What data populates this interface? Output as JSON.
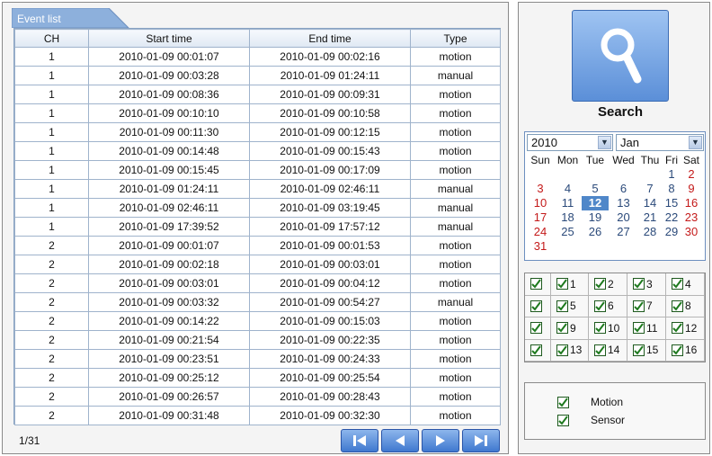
{
  "event_list": {
    "tab_label": "Event list",
    "columns": [
      "CH",
      "Start time",
      "End time",
      "Type"
    ],
    "rows": [
      [
        "1",
        "2010-01-09 00:01:07",
        "2010-01-09 00:02:16",
        "motion"
      ],
      [
        "1",
        "2010-01-09 00:03:28",
        "2010-01-09 01:24:11",
        "manual"
      ],
      [
        "1",
        "2010-01-09 00:08:36",
        "2010-01-09 00:09:31",
        "motion"
      ],
      [
        "1",
        "2010-01-09 00:10:10",
        "2010-01-09 00:10:58",
        "motion"
      ],
      [
        "1",
        "2010-01-09 00:11:30",
        "2010-01-09 00:12:15",
        "motion"
      ],
      [
        "1",
        "2010-01-09 00:14:48",
        "2010-01-09 00:15:43",
        "motion"
      ],
      [
        "1",
        "2010-01-09 00:15:45",
        "2010-01-09 00:17:09",
        "motion"
      ],
      [
        "1",
        "2010-01-09 01:24:11",
        "2010-01-09 02:46:11",
        "manual"
      ],
      [
        "1",
        "2010-01-09 02:46:11",
        "2010-01-09 03:19:45",
        "manual"
      ],
      [
        "1",
        "2010-01-09 17:39:52",
        "2010-01-09 17:57:12",
        "manual"
      ],
      [
        "2",
        "2010-01-09 00:01:07",
        "2010-01-09 00:01:53",
        "motion"
      ],
      [
        "2",
        "2010-01-09 00:02:18",
        "2010-01-09 00:03:01",
        "motion"
      ],
      [
        "2",
        "2010-01-09 00:03:01",
        "2010-01-09 00:04:12",
        "motion"
      ],
      [
        "2",
        "2010-01-09 00:03:32",
        "2010-01-09 00:54:27",
        "manual"
      ],
      [
        "2",
        "2010-01-09 00:14:22",
        "2010-01-09 00:15:03",
        "motion"
      ],
      [
        "2",
        "2010-01-09 00:21:54",
        "2010-01-09 00:22:35",
        "motion"
      ],
      [
        "2",
        "2010-01-09 00:23:51",
        "2010-01-09 00:24:33",
        "motion"
      ],
      [
        "2",
        "2010-01-09 00:25:12",
        "2010-01-09 00:25:54",
        "motion"
      ],
      [
        "2",
        "2010-01-09 00:26:57",
        "2010-01-09 00:28:43",
        "motion"
      ],
      [
        "2",
        "2010-01-09 00:31:48",
        "2010-01-09 00:32:30",
        "motion"
      ]
    ],
    "page_indicator": "1/31",
    "nav_icons": [
      "first-page-icon",
      "previous-page-icon",
      "next-page-icon",
      "last-page-icon"
    ]
  },
  "search": {
    "label": "Search",
    "icon": "magnifier-icon"
  },
  "calendar": {
    "year": "2010",
    "month": "Jan",
    "weekdays": [
      "Sun",
      "Mon",
      "Tue",
      "Wed",
      "Thu",
      "Fri",
      "Sat"
    ],
    "weeks": [
      [
        "",
        "",
        "",
        "",
        "",
        "1",
        "2"
      ],
      [
        "3",
        "4",
        "5",
        "6",
        "7",
        "8",
        "9"
      ],
      [
        "10",
        "11",
        "12",
        "13",
        "14",
        "15",
        "16"
      ],
      [
        "17",
        "18",
        "19",
        "20",
        "21",
        "22",
        "23"
      ],
      [
        "24",
        "25",
        "26",
        "27",
        "28",
        "29",
        "30"
      ],
      [
        "31",
        "",
        "",
        "",
        "",
        "",
        ""
      ]
    ],
    "selected_day": "12"
  },
  "channels": {
    "labels": [
      "1",
      "2",
      "3",
      "4",
      "5",
      "6",
      "7",
      "8",
      "9",
      "10",
      "11",
      "12",
      "13",
      "14",
      "15",
      "16"
    ],
    "all_checked": true
  },
  "event_types": [
    {
      "label": "Motion",
      "checked": true
    },
    {
      "label": "Sensor",
      "checked": true
    }
  ],
  "colors": {
    "accent": "#4f87c9",
    "weekend": "#c41a1a",
    "check": "#1e7a1e"
  }
}
